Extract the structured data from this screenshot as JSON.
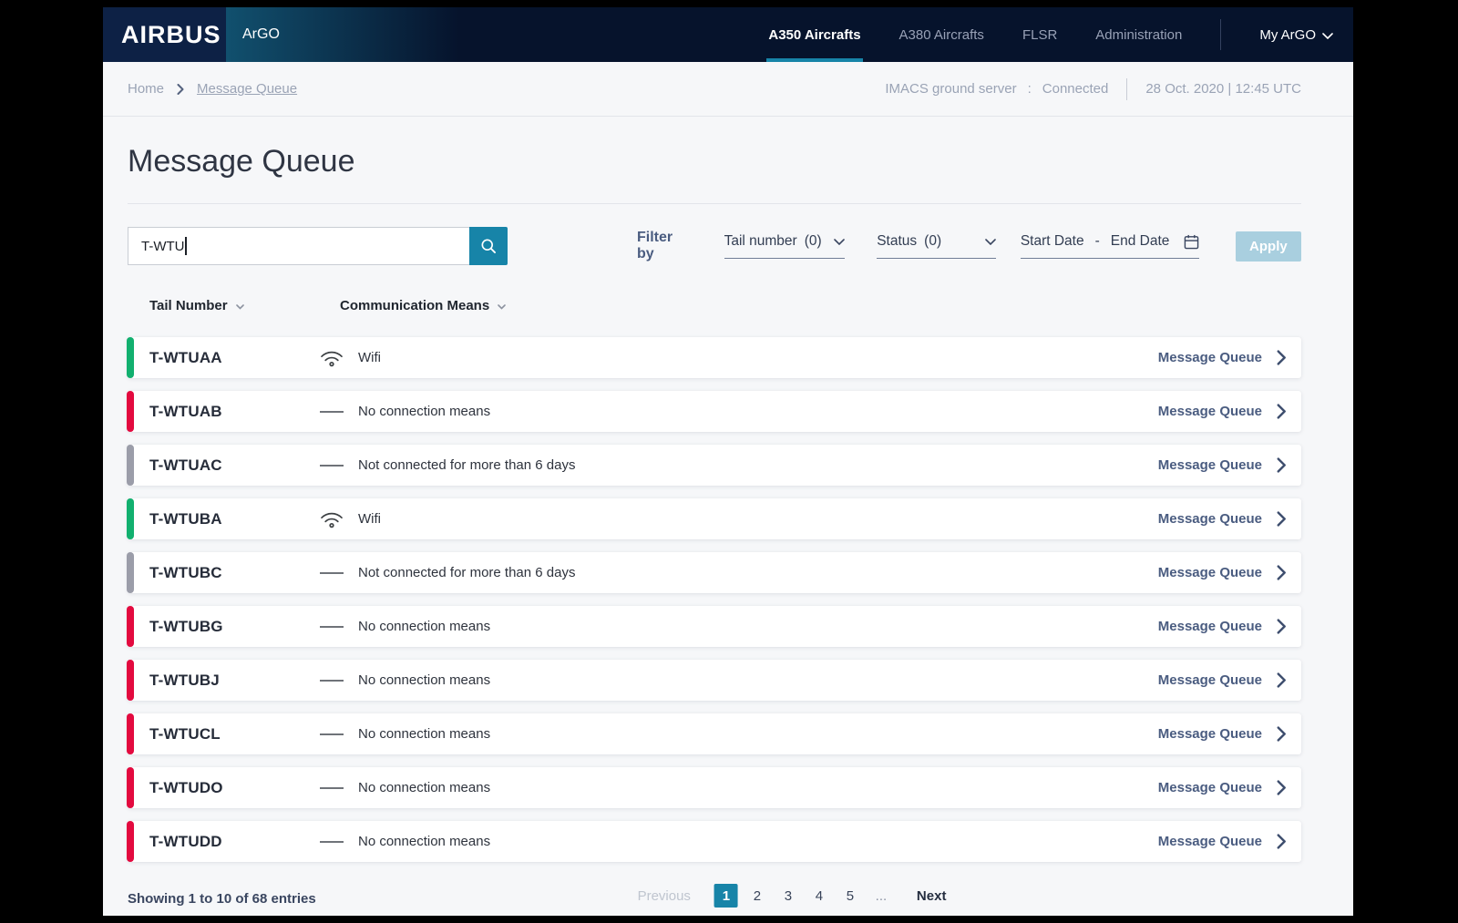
{
  "brand": {
    "logo": "AIRBUS",
    "app_name": "ArGO"
  },
  "nav": {
    "items": [
      {
        "label": "A350 Aircrafts",
        "active": true
      },
      {
        "label": "A380 Aircrafts",
        "active": false
      },
      {
        "label": "FLSR",
        "active": false
      },
      {
        "label": "Administration",
        "active": false
      }
    ],
    "account_label": "My ArGO"
  },
  "statusbar": {
    "breadcrumb": {
      "home": "Home",
      "current": "Message Queue"
    },
    "server_label": "IMACS ground server",
    "server_separator": ":",
    "server_status": "Connected",
    "datetime": "28 Oct. 2020 | 12:45 UTC"
  },
  "page": {
    "title": "Message Queue"
  },
  "toolbar": {
    "search": {
      "value": "T-WTU",
      "placeholder": ""
    },
    "filter_by_label": "Filter by",
    "tail_filter": {
      "label": "Tail number",
      "count": "(0)"
    },
    "status_filter": {
      "label": "Status",
      "count": "(0)"
    },
    "dates": {
      "start_label": "Start Date",
      "separator": "-",
      "end_label": "End Date"
    },
    "apply_label": "Apply"
  },
  "table": {
    "headers": {
      "tail": "Tail Number",
      "comm": "Communication Means"
    },
    "action_label": "Message Queue",
    "rows": [
      {
        "tail": "T-WTUAA",
        "status": "Wifi",
        "icon": "wifi",
        "bar": "green"
      },
      {
        "tail": "T-WTUAB",
        "status": "No connection means",
        "icon": "dash",
        "bar": "red"
      },
      {
        "tail": "T-WTUAC",
        "status": "Not connected for more than 6 days",
        "icon": "dash",
        "bar": "gray"
      },
      {
        "tail": "T-WTUBA",
        "status": "Wifi",
        "icon": "wifi",
        "bar": "green"
      },
      {
        "tail": "T-WTUBC",
        "status": "Not connected for more than 6 days",
        "icon": "dash",
        "bar": "gray"
      },
      {
        "tail": "T-WTUBG",
        "status": "No connection means",
        "icon": "dash",
        "bar": "red"
      },
      {
        "tail": "T-WTUBJ",
        "status": "No connection means",
        "icon": "dash",
        "bar": "red"
      },
      {
        "tail": "T-WTUCL",
        "status": "No connection means",
        "icon": "dash",
        "bar": "red"
      },
      {
        "tail": "T-WTUDO",
        "status": "No connection means",
        "icon": "dash",
        "bar": "red"
      },
      {
        "tail": "T-WTUDD",
        "status": "No connection means",
        "icon": "dash",
        "bar": "red"
      }
    ]
  },
  "footer": {
    "summary": "Showing 1 to 10 of 68 entries",
    "pagination": {
      "previous_label": "Previous",
      "pages": [
        "1",
        "2",
        "3",
        "4",
        "5",
        "..."
      ],
      "active_index": 0,
      "next_label": "Next"
    }
  },
  "icons": {
    "search": "magnifier",
    "wifi": "wifi-waves",
    "no_connection": "horizontal-dash",
    "not_connected": "horizontal-dash",
    "calendar": "calendar",
    "dropdown": "chevron-down",
    "account": "chevron-down",
    "row_action": "chevron-right",
    "breadcrumb_separator": "chevron-right",
    "sort": "caret-down"
  },
  "colors": {
    "accent_teal": "#1784A8",
    "navy_header": "#06132C",
    "status_green": "#12B06F",
    "status_red": "#E30A3F",
    "status_gray": "#9B9DA9",
    "apply_disabled": "#A9CFDF"
  }
}
